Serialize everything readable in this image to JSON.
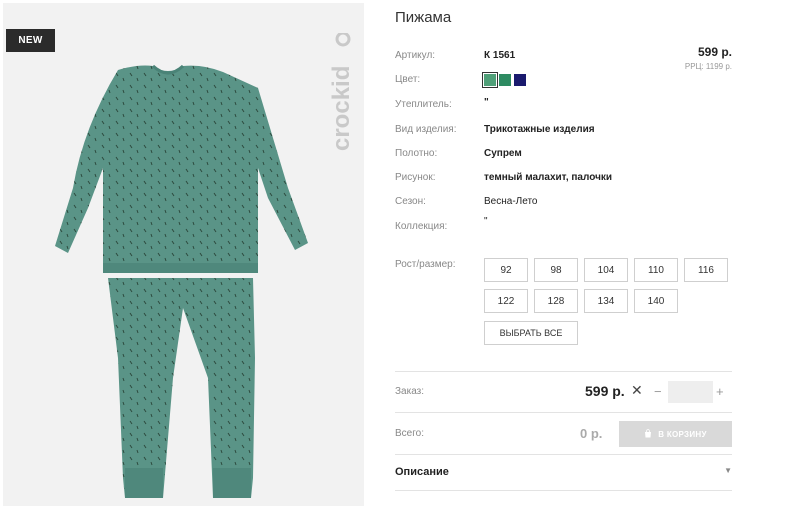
{
  "gallery": {
    "badge": "NEW",
    "brand": "crockid"
  },
  "product": {
    "title": "Пижама",
    "price": "599 р.",
    "rrp": "РРЦ: 1199 р.",
    "attributes": [
      {
        "label": "Артикул:",
        "value": "К 1561"
      },
      {
        "label": "Цвет:",
        "value": ""
      },
      {
        "label": "Утеплитель:",
        "value": "\""
      },
      {
        "label": "Вид изделия:",
        "value": "Трикотажные изделия"
      },
      {
        "label": "Полотно:",
        "value": "Супрем"
      },
      {
        "label": "Рисунок:",
        "value": "темный малахит, палочки"
      },
      {
        "label": "Сезон:",
        "value": "Весна-Лето"
      },
      {
        "label": "Коллекция:",
        "value": "\""
      }
    ],
    "colors": [
      "#4f9f78",
      "#2e8b62",
      "#1a1a6e"
    ],
    "size_label": "Рост/размер:",
    "sizes": [
      "92",
      "98",
      "104",
      "110",
      "116",
      "122",
      "128",
      "134",
      "140"
    ],
    "select_all": "ВЫБРАТЬ ВСЕ"
  },
  "order": {
    "label": "Заказ:",
    "price": "599 р.",
    "times": "✕",
    "minus": "−",
    "plus": "+",
    "qty": ""
  },
  "total": {
    "label": "Всего:",
    "value": "0 р.",
    "cart_button": "В КОРЗИНУ"
  },
  "description": {
    "label": "Описание",
    "arrow": "▼"
  }
}
